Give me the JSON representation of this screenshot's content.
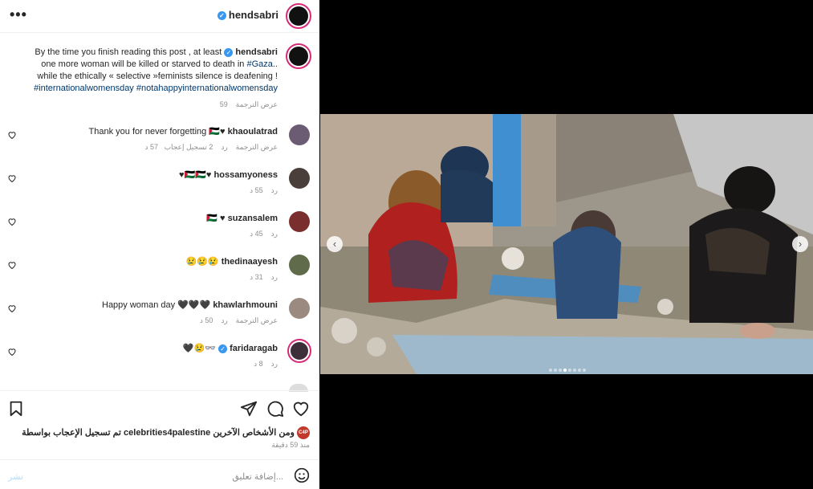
{
  "header": {
    "username": "hendsabri",
    "more_label": "•••"
  },
  "caption": {
    "text_before": "By the time you finish reading this post , at least",
    "author": "hendsabri",
    "line2_before": "one more woman will be killed or starved to death in",
    "gaza_tag": "#Gaza",
    "line2_after": "..",
    "line3": "while the ethically « selective »feminists silence is deafening !",
    "tags": "#internationalwomensday #notahappyinternationalwomensday",
    "time": "59",
    "see_translation": "عرض الترجمة"
  },
  "comments": [
    {
      "user": "khaoulatrad",
      "text": "Thank you for never forgetting 🇵🇸♥",
      "time": "57 د",
      "likes": "2 تسجيل إعجاب",
      "reply": "رد",
      "translate": "عرض الترجمة",
      "avatar_color": "#6b5b73"
    },
    {
      "user": "hossamyoness",
      "text": "♥🇵🇸🇵🇸♥",
      "time": "55 د",
      "reply": "رد",
      "avatar_color": "#4a3f3a"
    },
    {
      "user": "suzansalem",
      "text": "🇵🇸 ♥",
      "time": "45 د",
      "reply": "رد",
      "avatar_color": "#7a2e2e"
    },
    {
      "user": "thedinaayesh",
      "text": "😢😢😢",
      "time": "31 د",
      "reply": "رد",
      "avatar_color": "#5f6b4a"
    },
    {
      "user": "khawlarhmouni",
      "text": "Happy woman day 🖤🖤🖤",
      "time": "50 د",
      "reply": "رد",
      "translate": "عرض الترجمة",
      "avatar_color": "#9a8a80"
    },
    {
      "user": "faridaragab",
      "text": "🖤😢👓",
      "time": "8 د",
      "reply": "رد",
      "avatar_color": "#3d2f3a"
    }
  ],
  "actions": {
    "like_icon": "heart-icon",
    "comment_icon": "comment-icon",
    "share_icon": "paper-plane-icon",
    "save_icon": "bookmark-icon",
    "liked_by": "تم تسجيل الإعجاب بواسطة celebrities4palestine ومن الأشخاص الآخرين",
    "liked_by_avatar": "C4P",
    "time_ago": "منذ 59 دقيقة"
  },
  "add_comment": {
    "placeholder": "إضافة تعليق...",
    "post_label": "نشر",
    "emoji_icon": "smiley-icon"
  },
  "carousel": {
    "prev": "‹",
    "next": "›",
    "slide_count": 8,
    "active_slide": 4
  }
}
